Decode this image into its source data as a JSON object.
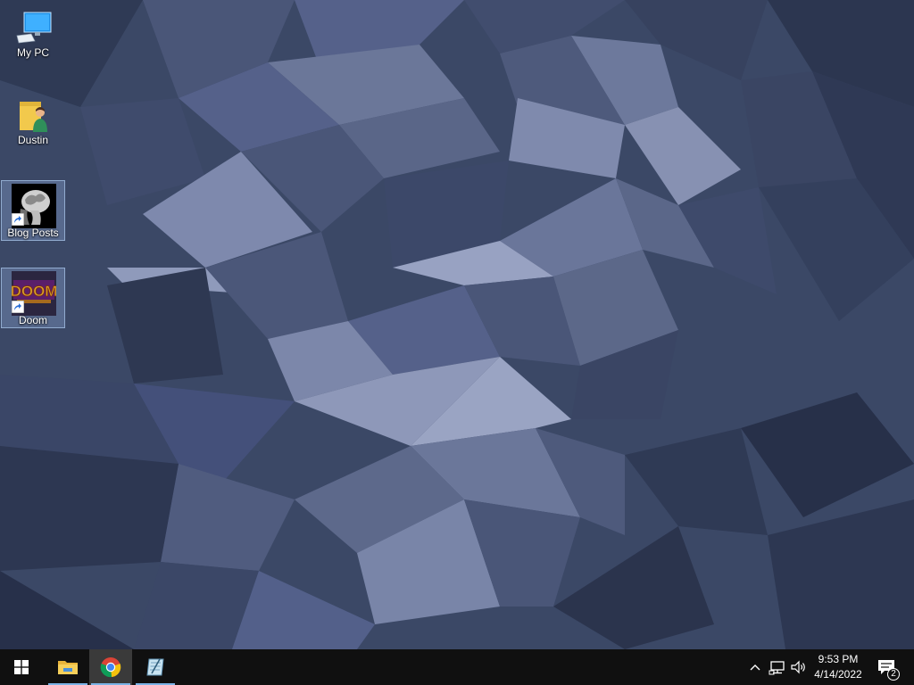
{
  "desktop": {
    "icons": [
      {
        "label": "My PC",
        "icon": "computer-icon",
        "selected": false
      },
      {
        "label": "Dustin",
        "icon": "user-folder-icon",
        "selected": false
      },
      {
        "label": "Blog Posts",
        "icon": "brain-scan-icon",
        "selected": true,
        "shortcut": true
      },
      {
        "label": "Doom",
        "icon": "doom-logo-icon",
        "selected": true,
        "shortcut": true
      }
    ]
  },
  "taskbar": {
    "start_icon": "windows-logo-icon",
    "pinned": [
      {
        "name": "File Explorer",
        "icon": "folder-icon",
        "running": true,
        "active": false
      },
      {
        "name": "Google Chrome",
        "icon": "chrome-icon",
        "running": true,
        "active": true
      },
      {
        "name": "Notepad",
        "icon": "notepad-icon",
        "running": true,
        "active": false
      }
    ],
    "tray": {
      "icons": [
        "chevron-up-icon",
        "network-icon",
        "volume-icon"
      ],
      "time": "9:53 PM",
      "date": "4/14/2022",
      "notification_count": "2"
    }
  },
  "colors": {
    "wallpaper_base": "#3b4866",
    "taskbar": "#101010",
    "accent_underline": "#7ab3e6"
  }
}
